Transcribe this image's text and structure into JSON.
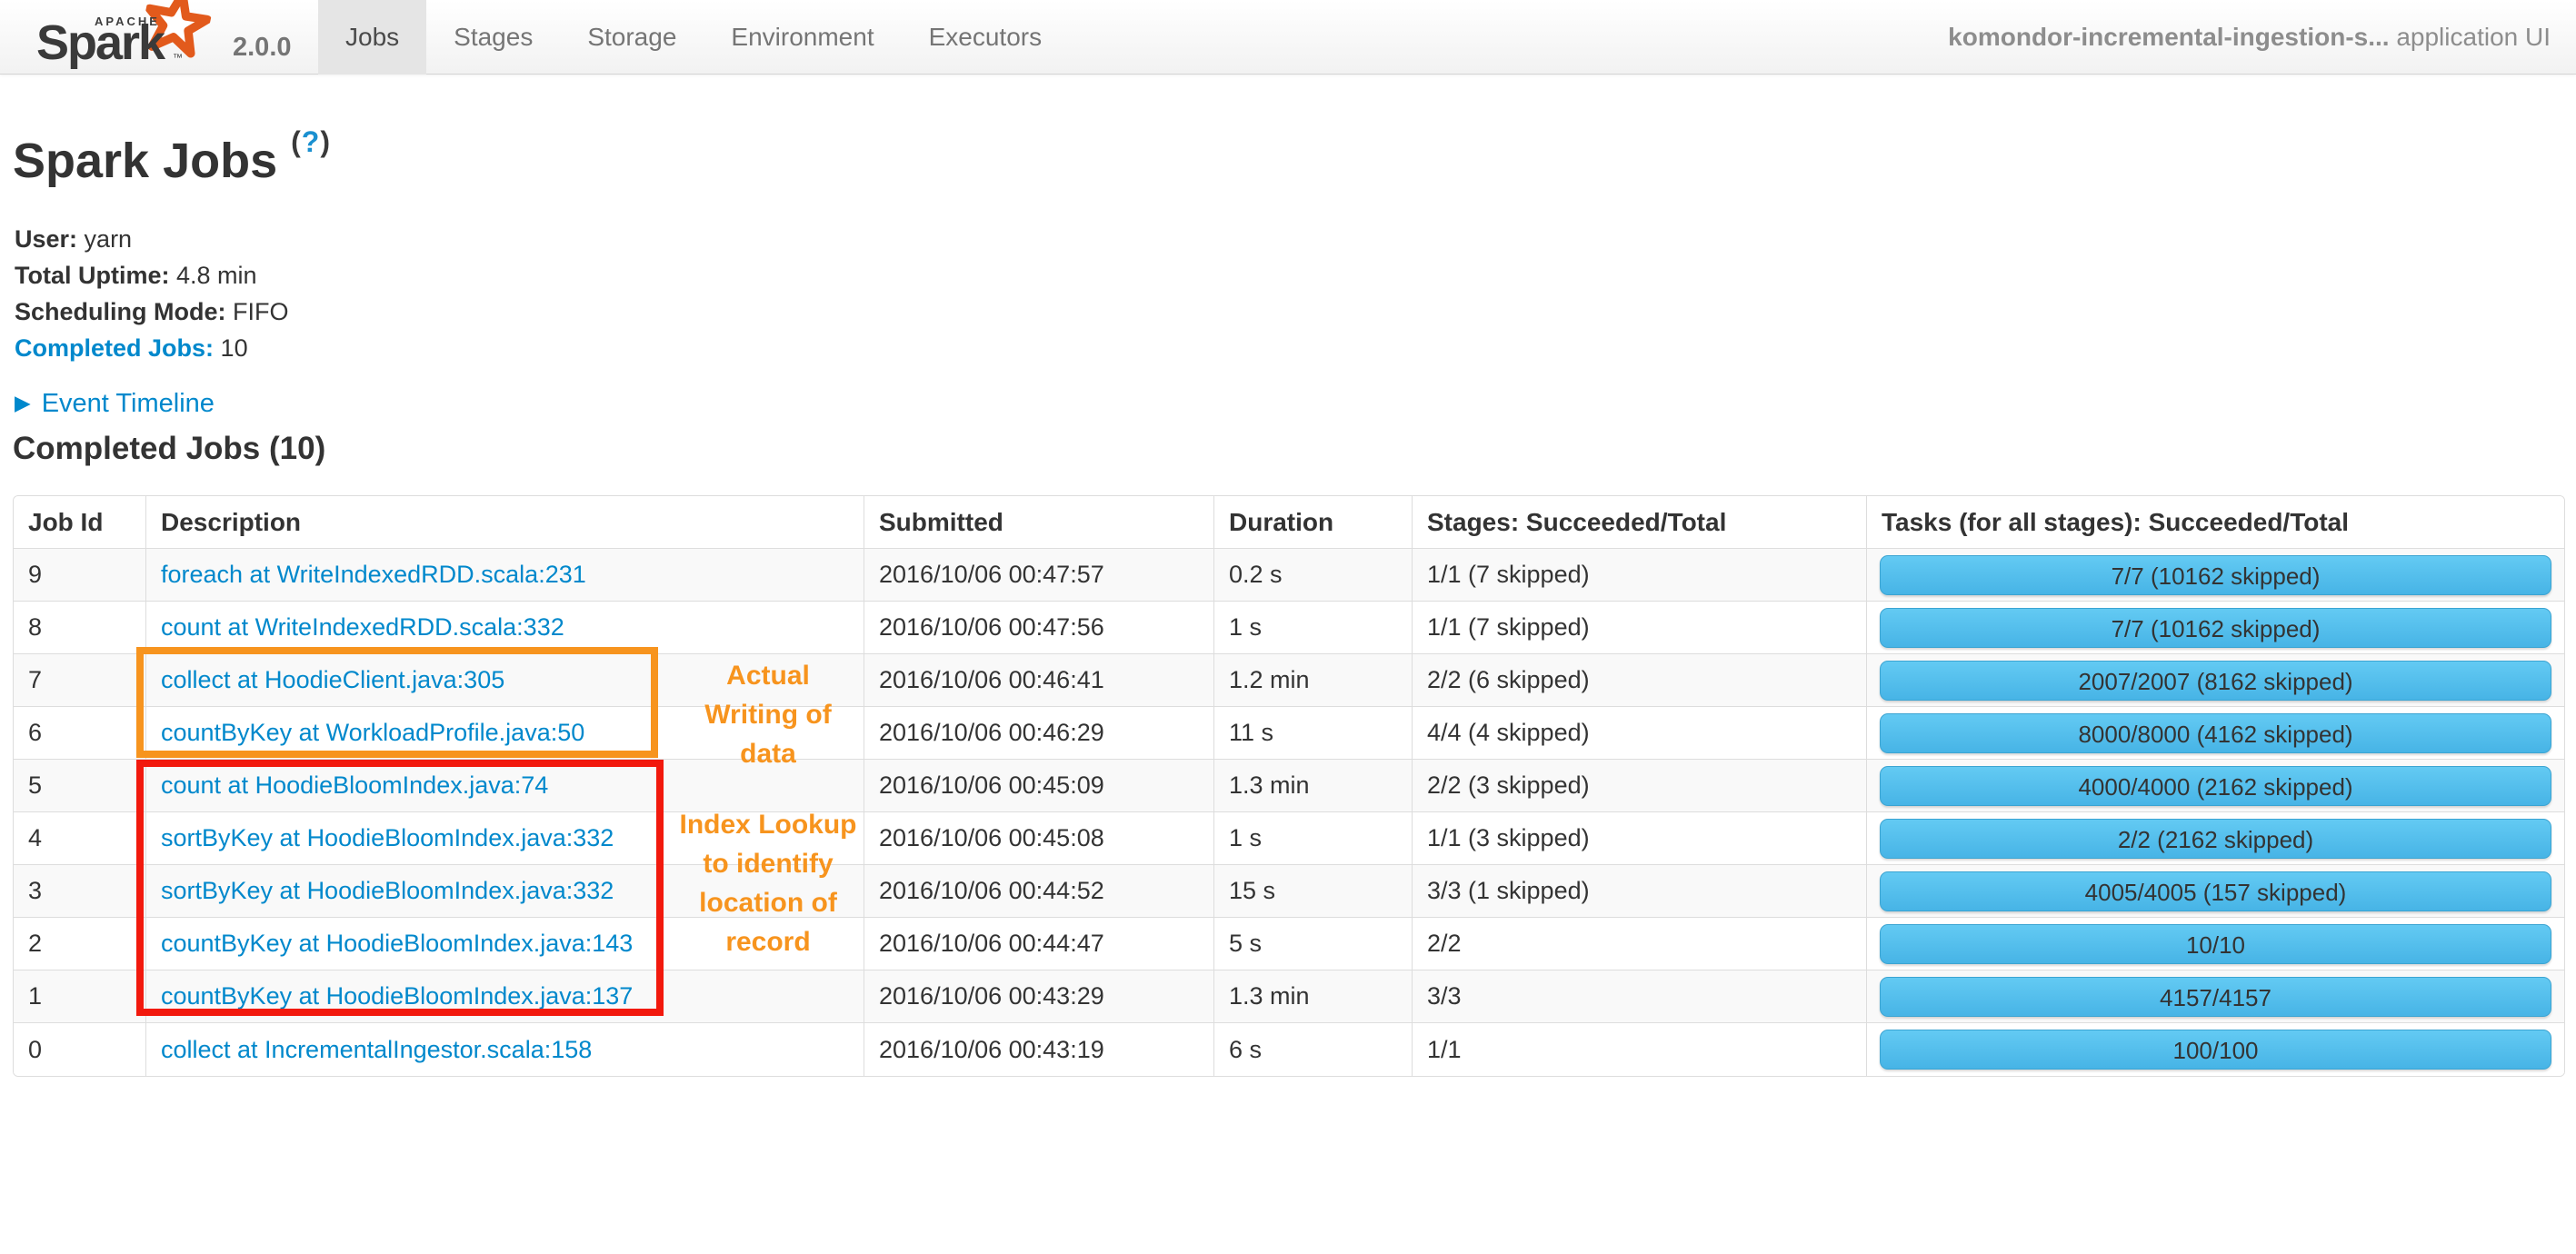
{
  "navbar": {
    "logo": {
      "apache": "APACHE",
      "brand": "Spark",
      "trademark": "™",
      "version": "2.0.0"
    },
    "tabs": [
      {
        "label": "Jobs"
      },
      {
        "label": "Stages"
      },
      {
        "label": "Storage"
      },
      {
        "label": "Environment"
      },
      {
        "label": "Executors"
      }
    ],
    "app_name": "komondor-incremental-ingestion-s...",
    "app_suffix": " application UI"
  },
  "page": {
    "title": "Spark Jobs",
    "help_open": "(",
    "help_q": "?",
    "help_close": ")"
  },
  "summary": {
    "user_label": "User:",
    "user_value": "yarn",
    "uptime_label": "Total Uptime:",
    "uptime_value": "4.8 min",
    "scheduling_label": "Scheduling Mode:",
    "scheduling_value": "FIFO",
    "completed_label": "Completed Jobs:",
    "completed_value": "10"
  },
  "event_timeline": {
    "arrow": "▶",
    "label": "Event Timeline"
  },
  "section_title": "Completed Jobs (10)",
  "table": {
    "headers": {
      "job_id": "Job Id",
      "description": "Description",
      "submitted": "Submitted",
      "duration": "Duration",
      "stages": "Stages: Succeeded/Total",
      "tasks": "Tasks (for all stages): Succeeded/Total"
    },
    "rows": [
      {
        "job_id": "9",
        "description": "foreach at WriteIndexedRDD.scala:231",
        "submitted": "2016/10/06 00:47:57",
        "duration": "0.2 s",
        "stages": "1/1 (7 skipped)",
        "tasks": "7/7 (10162 skipped)"
      },
      {
        "job_id": "8",
        "description": "count at WriteIndexedRDD.scala:332",
        "submitted": "2016/10/06 00:47:56",
        "duration": "1 s",
        "stages": "1/1 (7 skipped)",
        "tasks": "7/7 (10162 skipped)"
      },
      {
        "job_id": "7",
        "description": "collect at HoodieClient.java:305",
        "submitted": "2016/10/06 00:46:41",
        "duration": "1.2 min",
        "stages": "2/2 (6 skipped)",
        "tasks": "2007/2007 (8162 skipped)"
      },
      {
        "job_id": "6",
        "description": "countByKey at WorkloadProfile.java:50",
        "submitted": "2016/10/06 00:46:29",
        "duration": "11 s",
        "stages": "4/4 (4 skipped)",
        "tasks": "8000/8000 (4162 skipped)"
      },
      {
        "job_id": "5",
        "description": "count at HoodieBloomIndex.java:74",
        "submitted": "2016/10/06 00:45:09",
        "duration": "1.3 min",
        "stages": "2/2 (3 skipped)",
        "tasks": "4000/4000 (2162 skipped)"
      },
      {
        "job_id": "4",
        "description": "sortByKey at HoodieBloomIndex.java:332",
        "submitted": "2016/10/06 00:45:08",
        "duration": "1 s",
        "stages": "1/1 (3 skipped)",
        "tasks": "2/2 (2162 skipped)"
      },
      {
        "job_id": "3",
        "description": "sortByKey at HoodieBloomIndex.java:332",
        "submitted": "2016/10/06 00:44:52",
        "duration": "15 s",
        "stages": "3/3 (1 skipped)",
        "tasks": "4005/4005 (157 skipped)"
      },
      {
        "job_id": "2",
        "description": "countByKey at HoodieBloomIndex.java:143",
        "submitted": "2016/10/06 00:44:47",
        "duration": "5 s",
        "stages": "2/2",
        "tasks": "10/10"
      },
      {
        "job_id": "1",
        "description": "countByKey at HoodieBloomIndex.java:137",
        "submitted": "2016/10/06 00:43:29",
        "duration": "1.3 min",
        "stages": "3/3",
        "tasks": "4157/4157"
      },
      {
        "job_id": "0",
        "description": "collect at IncrementalIngestor.scala:158",
        "submitted": "2016/10/06 00:43:19",
        "duration": "6 s",
        "stages": "1/1",
        "tasks": "100/100"
      }
    ]
  },
  "annotations": {
    "writing": {
      "lines": [
        "Actual",
        "Writing of",
        "data"
      ],
      "box_color": "#f7941e"
    },
    "index_lookup": {
      "lines": [
        "Index Lookup",
        "to identify",
        "location of",
        "record"
      ],
      "box_color": "#f2190d"
    },
    "text_color": "#f7941e"
  },
  "colors": {
    "link_blue": "#0088cc",
    "progress_bar_top": "#63caf3",
    "progress_bar_bottom": "#47b4e6",
    "navbar_active_tab": "#e5e5e5",
    "spark_orange": "#e25a1c"
  }
}
